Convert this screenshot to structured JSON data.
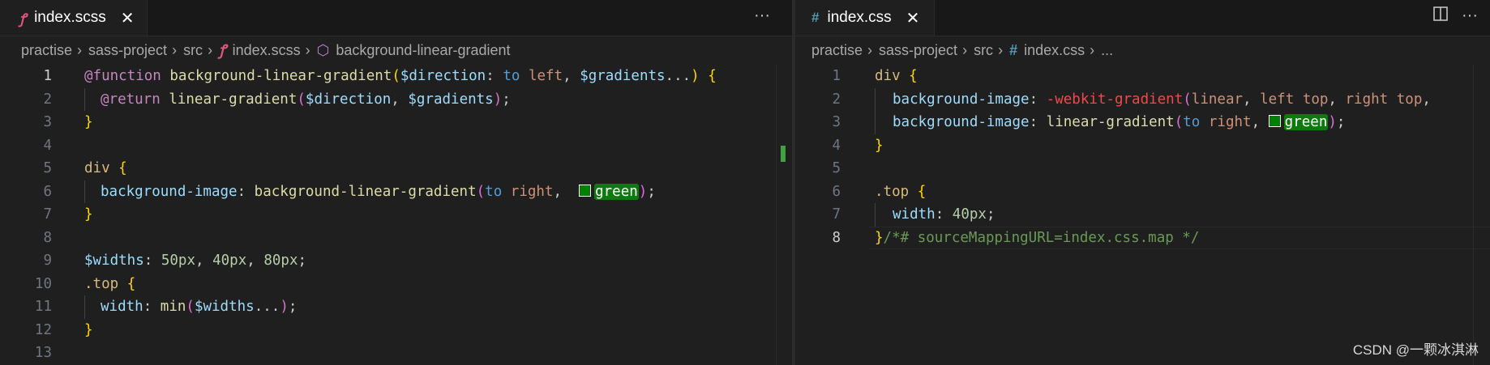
{
  "left": {
    "tab": {
      "label": "index.scss",
      "icon": "sass-icon",
      "close": "✕"
    },
    "more": "···",
    "breadcrumb": [
      "practise",
      "sass-project",
      "src",
      "index.scss",
      "background-linear-gradient"
    ],
    "line_numbers": [
      "1",
      "2",
      "3",
      "4",
      "5",
      "6",
      "7",
      "8",
      "9",
      "10",
      "11",
      "12",
      "13"
    ],
    "code": {
      "l1": {
        "kw": "@function",
        "name": "background-linear-gradient",
        "p1": "(",
        "v1": "$direction",
        "colon": ":",
        "to": "to",
        "left": "left",
        "comma": ",",
        "v2": "$gradients",
        "dots": "...",
        "p2": ")",
        "brace": "{"
      },
      "l2": {
        "kw": "@return",
        "fn": "linear-gradient",
        "p1": "(",
        "v1": "$direction",
        "comma": ",",
        "v2": "$gradients",
        "p2": ")",
        "semi": ";"
      },
      "l3": {
        "brace": "}"
      },
      "l5": {
        "sel": "div",
        "brace": "{"
      },
      "l6": {
        "prop": "background-image",
        "colon": ":",
        "fn": "background-linear-gradient",
        "p1": "(",
        "to": "to",
        "right": "right",
        "comma": ",",
        "color": "green",
        "p2": ")",
        "semi": ";"
      },
      "l7": {
        "brace": "}"
      },
      "l9": {
        "var": "$widths",
        "colon": ":",
        "n1": "50px",
        "c1": ",",
        "n2": "40px",
        "c2": ",",
        "n3": "80px",
        "semi": ";"
      },
      "l10": {
        "sel": ".top",
        "brace": "{"
      },
      "l11": {
        "prop": "width",
        "colon": ":",
        "fn": "min",
        "p1": "(",
        "var": "$widths",
        "dots": "...",
        "p2": ")",
        "semi": ";"
      },
      "l12": {
        "brace": "}"
      }
    }
  },
  "right": {
    "tab": {
      "label": "index.css",
      "icon": "#",
      "close": "✕"
    },
    "breadcrumb": [
      "practise",
      "sass-project",
      "src",
      "index.css",
      "..."
    ],
    "line_numbers": [
      "1",
      "2",
      "3",
      "4",
      "5",
      "6",
      "7",
      "8"
    ],
    "code": {
      "l1": {
        "sel": "div",
        "brace": "{"
      },
      "l2": {
        "prop": "background-image",
        "colon": ":",
        "fn": "-webkit-gradient",
        "p1": "(",
        "a1": "linear",
        "c1": ",",
        "a2": "left",
        "a3": "top",
        "c2": ",",
        "a4": "right",
        "a5": "top",
        "c3": ","
      },
      "l3": {
        "prop": "background-image",
        "colon": ":",
        "fn": "linear-gradient",
        "p1": "(",
        "to": "to",
        "right": "right",
        "comma": ",",
        "color": "green",
        "p2": ")",
        "semi": ";"
      },
      "l4": {
        "brace": "}"
      },
      "l6": {
        "sel": ".top",
        "brace": "{"
      },
      "l7": {
        "prop": "width",
        "colon": ":",
        "val": "40px",
        "semi": ";"
      },
      "l8": {
        "brace": "}",
        "comment": "/*# sourceMappingURL=index.css.map */"
      }
    }
  },
  "watermark": "CSDN @一颗冰淇淋"
}
